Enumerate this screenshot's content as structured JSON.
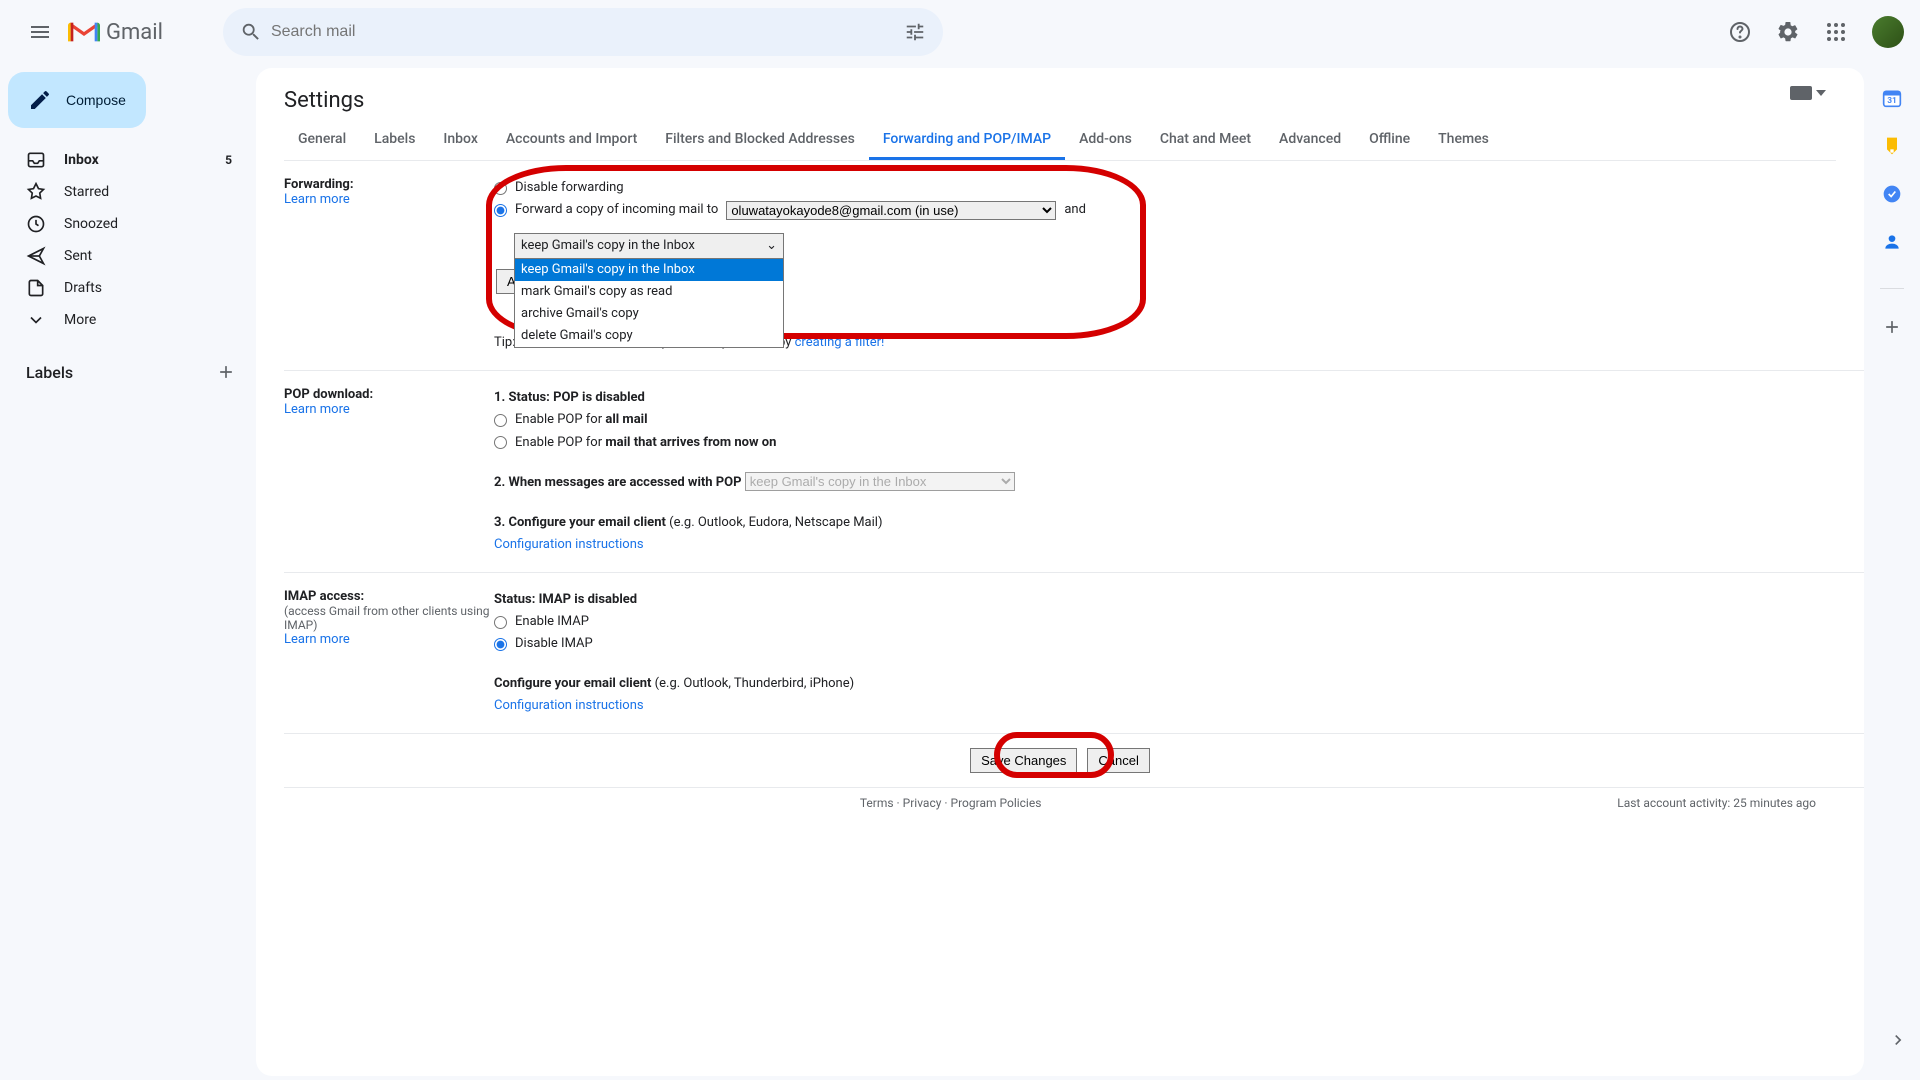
{
  "header": {
    "logo_text": "Gmail",
    "search_placeholder": "Search mail"
  },
  "sidebar": {
    "compose": "Compose",
    "items": [
      {
        "label": "Inbox",
        "count": "5"
      },
      {
        "label": "Starred"
      },
      {
        "label": "Snoozed"
      },
      {
        "label": "Sent"
      },
      {
        "label": "Drafts"
      },
      {
        "label": "More"
      }
    ],
    "labels_header": "Labels"
  },
  "settings": {
    "title": "Settings",
    "tabs": [
      "General",
      "Labels",
      "Inbox",
      "Accounts and Import",
      "Filters and Blocked Addresses",
      "Forwarding and POP/IMAP",
      "Add-ons",
      "Chat and Meet",
      "Advanced",
      "Offline",
      "Themes"
    ],
    "active_tab": "Forwarding and POP/IMAP",
    "forwarding": {
      "label": "Forwarding:",
      "learn_more": "Learn more",
      "disable": "Disable forwarding",
      "forward_copy": "Forward a copy of incoming mail to",
      "email_select": "oluwatayokayode8@gmail.com (in use)",
      "and": "and",
      "action_select": "keep Gmail's copy in the Inbox",
      "options": [
        "keep Gmail's copy in the Inbox",
        "mark Gmail's copy as read",
        "archive Gmail's copy",
        "delete Gmail's copy"
      ],
      "add_button": "Add a forwarding address",
      "tip_prefix": "Tip: You can also forward only some of your mail by ",
      "tip_link": "creating a filter!"
    },
    "pop": {
      "label": "POP download:",
      "learn_more": "Learn more",
      "status_prefix": "1. Status: ",
      "status": "POP is disabled",
      "enable_all_prefix": "Enable POP for ",
      "enable_all_bold": "all mail",
      "enable_now_prefix": "Enable POP for ",
      "enable_now_bold": "mail that arrives from now on",
      "when_accessed": "2. When messages are accessed with POP",
      "when_select": "keep Gmail's copy in the Inbox",
      "configure_prefix": "3. Configure your email client ",
      "configure_hint": "(e.g. Outlook, Eudora, Netscape Mail)",
      "config_link": "Configuration instructions"
    },
    "imap": {
      "label": "IMAP access:",
      "sub": "(access Gmail from other clients using IMAP)",
      "learn_more": "Learn more",
      "status_prefix": "Status: ",
      "status": "IMAP is disabled",
      "enable": "Enable IMAP",
      "disable": "Disable IMAP",
      "configure_prefix": "Configure your email client ",
      "configure_hint": "(e.g. Outlook, Thunderbird, iPhone)",
      "config_link": "Configuration instructions"
    },
    "buttons": {
      "save": "Save Changes",
      "cancel": "Cancel"
    },
    "footer": {
      "terms": "Terms",
      "privacy": "Privacy",
      "program": "Program Policies",
      "activity": "Last account activity: 25 minutes ago"
    }
  }
}
